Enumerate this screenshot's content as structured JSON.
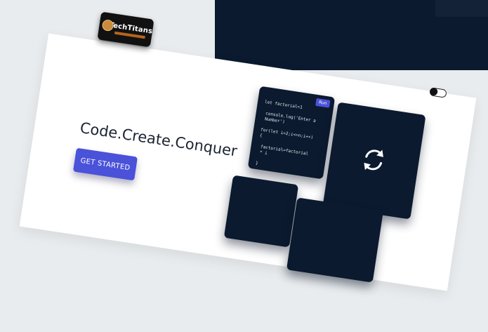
{
  "header": {
    "logo": {
      "text": "TechTitans",
      "icon": "techtitans-logo-icon"
    }
  },
  "hero": {
    "headline": "Code.Create.Conquer",
    "cta_label": "GET STARTED"
  },
  "theme_toggle": {
    "state": "off"
  },
  "editor": {
    "run_label": "Run",
    "code": "let factorial=1\n\n console.log('Enter a\n Number')\n\nfor(let i=2;i<=n;i++)\n{\n\n factorial=factorial\n * i\n\n}",
    "refresh_icon": "refresh-icon"
  },
  "colors": {
    "accent": "#4a52d9",
    "tile_bg": "#0b1a2e",
    "page_bg": "#ffffff",
    "outer_bg": "#e8ecee"
  }
}
